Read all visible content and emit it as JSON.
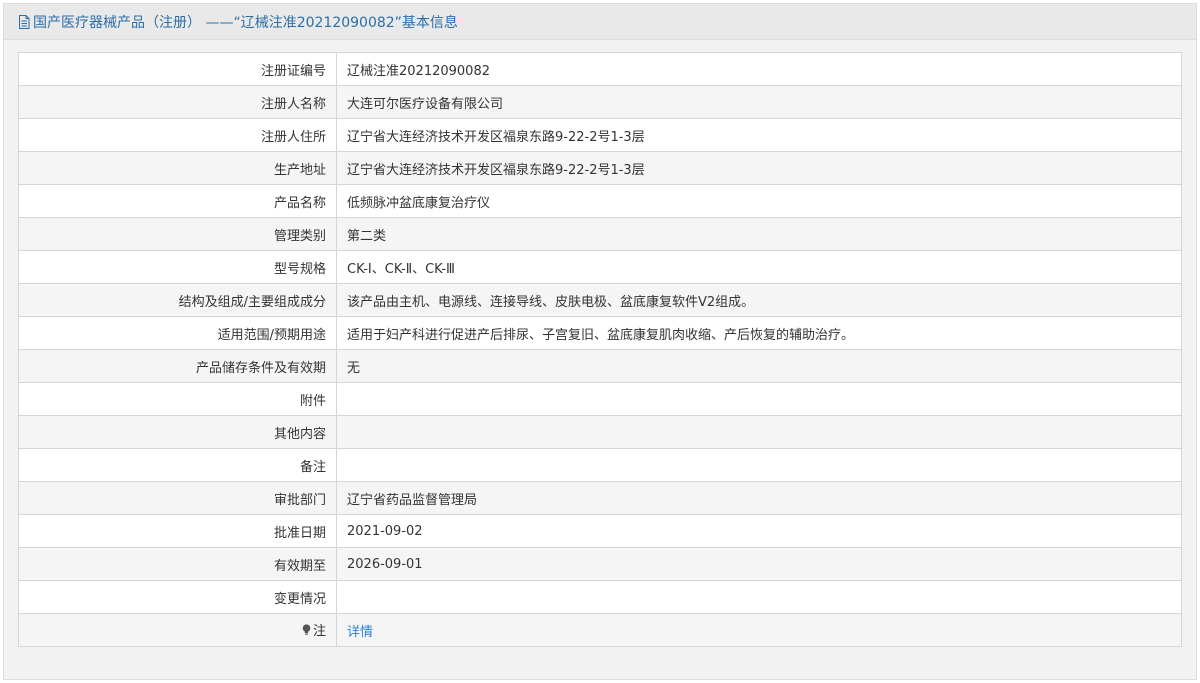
{
  "header": {
    "title": "国产医疗器械产品（注册） ——“辽械注准20212090082”基本信息",
    "icon": "document-icon",
    "title_color": "#2c6ea8"
  },
  "rows": [
    {
      "label": "注册证编号",
      "value": "辽械注准20212090082"
    },
    {
      "label": "注册人名称",
      "value": "大连可尔医疗设备有限公司"
    },
    {
      "label": "注册人住所",
      "value": "辽宁省大连经济技术开发区福泉东路9-22-2号1-3层"
    },
    {
      "label": "生产地址",
      "value": "辽宁省大连经济技术开发区福泉东路9-22-2号1-3层"
    },
    {
      "label": "产品名称",
      "value": "低频脉冲盆底康复治疗仪"
    },
    {
      "label": "管理类别",
      "value": "第二类"
    },
    {
      "label": "型号规格",
      "value": "CK-Ⅰ、CK-Ⅱ、CK-Ⅲ"
    },
    {
      "label": "结构及组成/主要组成成分",
      "value": "该产品由主机、电源线、连接导线、皮肤电极、盆底康复软件V2组成。"
    },
    {
      "label": "适用范围/预期用途",
      "value": "适用于妇产科进行促进产后排尿、子宫复旧、盆底康复肌肉收缩、产后恢复的辅助治疗。"
    },
    {
      "label": "产品储存条件及有效期",
      "value": "无"
    },
    {
      "label": "附件",
      "value": ""
    },
    {
      "label": "其他内容",
      "value": ""
    },
    {
      "label": "备注",
      "value": ""
    },
    {
      "label": "审批部门",
      "value": "辽宁省药品监督管理局"
    },
    {
      "label": "批准日期",
      "value": "2021-09-02"
    },
    {
      "label": "有效期至",
      "value": "2026-09-01"
    },
    {
      "label": "变更情况",
      "value": ""
    }
  ],
  "note_row": {
    "label": "注",
    "icon": "lightbulb-icon",
    "link_text": "详情",
    "link_color": "#2c7fd0"
  }
}
